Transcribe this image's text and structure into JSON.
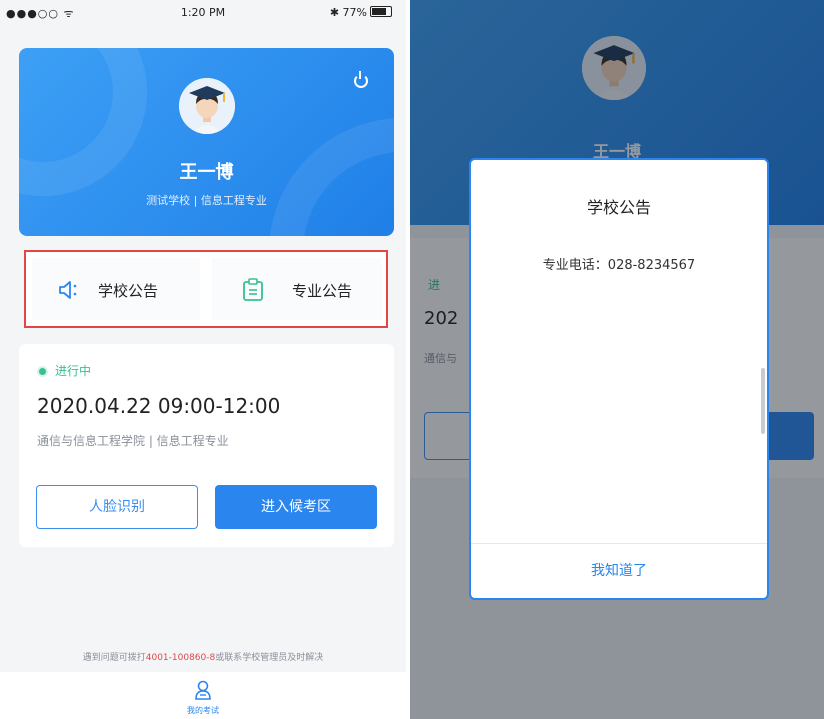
{
  "status_bar": {
    "signal": "●●●○○ ᯤ",
    "time": "1:20 PM",
    "battery": "✱ 77%"
  },
  "profile": {
    "name": "王一博",
    "school": "测试学校 | 信息工程专业"
  },
  "announcements": {
    "school_label": "学校公告",
    "major_label": "专业公告"
  },
  "exam": {
    "status": "进行中",
    "time": "2020.04.22  09:00-12:00",
    "department": "通信与信息工程学院 | 信息工程专业",
    "face_button": "人脸识别",
    "enter_button": "进入候考区"
  },
  "help": {
    "prefix": "遇到问题可拨打",
    "hotline": "4001-100860-8",
    "suffix": "或联系学校管理员及时解决"
  },
  "tabbar": {
    "label": "我的考试"
  },
  "right_bg": {
    "name": "王一博",
    "status": "进",
    "time": "202",
    "dept": "通信与"
  },
  "modal": {
    "title": "学校公告",
    "body": "专业电话：028-8234567",
    "confirm_button": "我知道了"
  },
  "colors": {
    "primary": "#2a86ee",
    "success": "#35c28e",
    "highlight_border": "#e14747"
  }
}
